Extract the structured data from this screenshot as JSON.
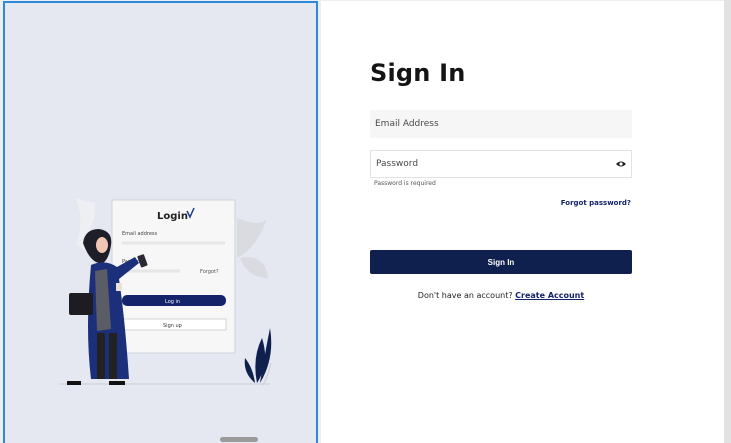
{
  "illustration": {
    "card_title": "Login",
    "email_label": "Email address",
    "password_label": "Password",
    "forgot_label": "Forgot?",
    "login_button": "Log in",
    "signup_button": "Sign up"
  },
  "form": {
    "title": "Sign In",
    "email_placeholder": "Email Address",
    "password_placeholder": "Password",
    "password_error": "Password is required",
    "forgot_password": "Forgot password?",
    "submit_label": "Sign In",
    "no_account_text": "Don't have an account?",
    "create_account_link": "Create Account"
  },
  "colors": {
    "accent": "#0f1f4e",
    "left_panel_bg": "#e5e8f0",
    "selection_border": "#2e8ad8"
  },
  "icons": {
    "password_toggle": "eye-icon",
    "logo_mark": "leaf-icon"
  }
}
